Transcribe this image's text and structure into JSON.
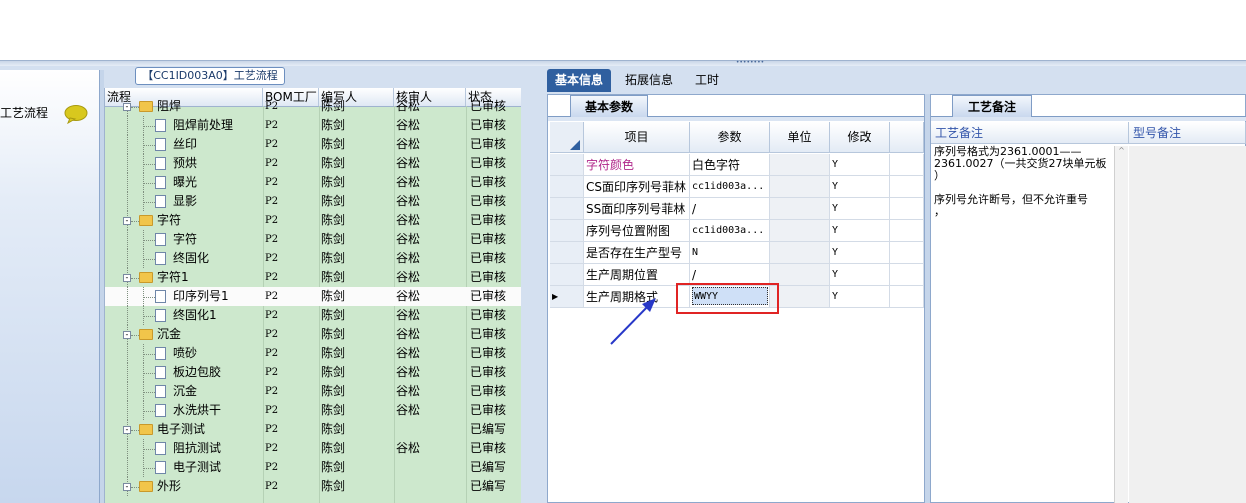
{
  "header": {
    "grip": "••••••••"
  },
  "left_panel": {
    "label": "工艺流程",
    "icon": "speech-bubble-icon"
  },
  "tree_panel": {
    "title": "【CC1ID003A0】工艺流程",
    "columns": [
      "流程",
      "BOM工厂",
      "编写人",
      "核审人",
      "状态"
    ],
    "rows": [
      {
        "name": "阻焊",
        "level": 0,
        "kind": "folder",
        "factory": "P2",
        "author": "陈剑",
        "reviewer": "谷松",
        "status": "已审核"
      },
      {
        "name": "阻焊前处理",
        "level": 1,
        "kind": "doc",
        "factory": "P2",
        "author": "陈剑",
        "reviewer": "谷松",
        "status": "已审核"
      },
      {
        "name": "丝印",
        "level": 1,
        "kind": "doc",
        "factory": "P2",
        "author": "陈剑",
        "reviewer": "谷松",
        "status": "已审核"
      },
      {
        "name": "预烘",
        "level": 1,
        "kind": "doc",
        "factory": "P2",
        "author": "陈剑",
        "reviewer": "谷松",
        "status": "已审核"
      },
      {
        "name": "曝光",
        "level": 1,
        "kind": "doc",
        "factory": "P2",
        "author": "陈剑",
        "reviewer": "谷松",
        "status": "已审核"
      },
      {
        "name": "显影",
        "level": 1,
        "kind": "doc",
        "factory": "P2",
        "author": "陈剑",
        "reviewer": "谷松",
        "status": "已审核"
      },
      {
        "name": "字符",
        "level": 0,
        "kind": "folder",
        "factory": "P2",
        "author": "陈剑",
        "reviewer": "谷松",
        "status": "已审核"
      },
      {
        "name": "字符",
        "level": 1,
        "kind": "doc",
        "factory": "P2",
        "author": "陈剑",
        "reviewer": "谷松",
        "status": "已审核"
      },
      {
        "name": "终固化",
        "level": 1,
        "kind": "doc",
        "factory": "P2",
        "author": "陈剑",
        "reviewer": "谷松",
        "status": "已审核"
      },
      {
        "name": "字符1",
        "level": 0,
        "kind": "folder",
        "factory": "P2",
        "author": "陈剑",
        "reviewer": "谷松",
        "status": "已审核"
      },
      {
        "name": "印序列号1",
        "level": 1,
        "kind": "doc",
        "factory": "P2",
        "author": "陈剑",
        "reviewer": "谷松",
        "status": "已审核",
        "selected": true
      },
      {
        "name": "终固化1",
        "level": 1,
        "kind": "doc",
        "factory": "P2",
        "author": "陈剑",
        "reviewer": "谷松",
        "status": "已审核"
      },
      {
        "name": "沉金",
        "level": 0,
        "kind": "folder",
        "factory": "P2",
        "author": "陈剑",
        "reviewer": "谷松",
        "status": "已审核"
      },
      {
        "name": "喷砂",
        "level": 1,
        "kind": "doc",
        "factory": "P2",
        "author": "陈剑",
        "reviewer": "谷松",
        "status": "已审核"
      },
      {
        "name": "板边包胶",
        "level": 1,
        "kind": "doc",
        "factory": "P2",
        "author": "陈剑",
        "reviewer": "谷松",
        "status": "已审核"
      },
      {
        "name": "沉金",
        "level": 1,
        "kind": "doc",
        "factory": "P2",
        "author": "陈剑",
        "reviewer": "谷松",
        "status": "已审核"
      },
      {
        "name": "水洗烘干",
        "level": 1,
        "kind": "doc",
        "factory": "P2",
        "author": "陈剑",
        "reviewer": "谷松",
        "status": "已审核"
      },
      {
        "name": "电子测试",
        "level": 0,
        "kind": "folder",
        "factory": "P2",
        "author": "陈剑",
        "reviewer": "",
        "status": "已编写"
      },
      {
        "name": "阻抗测试",
        "level": 1,
        "kind": "doc",
        "factory": "P2",
        "author": "陈剑",
        "reviewer": "谷松",
        "status": "已审核"
      },
      {
        "name": "电子测试",
        "level": 1,
        "kind": "doc",
        "factory": "P2",
        "author": "陈剑",
        "reviewer": "",
        "status": "已编写"
      },
      {
        "name": "外形",
        "level": 0,
        "kind": "folder",
        "factory": "P2",
        "author": "陈剑",
        "reviewer": "",
        "status": "已编写"
      }
    ]
  },
  "tabs": [
    "基本信息",
    "拓展信息",
    "工时"
  ],
  "params_panel": {
    "tab": "基本参数",
    "columns": [
      "项目",
      "参数",
      "单位",
      "修改"
    ],
    "rows": [
      {
        "item": "字符颜色",
        "value": "白色字符",
        "unit": "",
        "modify": "Y",
        "highlight": true
      },
      {
        "item": "CS面印序列号菲林",
        "value": "cc1id003a...",
        "unit": "",
        "modify": "Y"
      },
      {
        "item": "SS面印序列号菲林",
        "value": "/",
        "unit": "",
        "modify": "Y"
      },
      {
        "item": "序列号位置附图",
        "value": "cc1id003a...",
        "unit": "",
        "modify": "Y"
      },
      {
        "item": "是否存在生产型号",
        "value": "N",
        "unit": "",
        "modify": "Y"
      },
      {
        "item": "生产周期位置",
        "value": "/",
        "unit": "",
        "modify": "Y"
      },
      {
        "item": "生产周期格式",
        "value": "WWYY",
        "unit": "",
        "modify": "Y",
        "current": true
      }
    ]
  },
  "notes_panel": {
    "tab": "工艺备注",
    "columns": [
      "工艺备注",
      "型号备注"
    ],
    "note_lines": [
      "序列号格式为2361.0001——",
      "2361.0027（一共交货27块单元板",
      "）",
      "",
      "序列号允许断号，但不允许重号",
      "，"
    ]
  },
  "colors": {
    "tree_bg": "#cde8cd",
    "active_tab": "#2f5f9f",
    "highlight_text": "#b0278a",
    "callout": "#e02424",
    "arrow": "#2838c8"
  }
}
